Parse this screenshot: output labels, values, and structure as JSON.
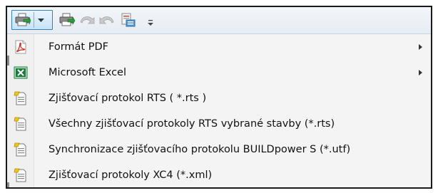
{
  "toolbar": {
    "buttons": [
      {
        "name": "print-split-icon"
      },
      {
        "name": "print-icon"
      },
      {
        "name": "undo-icon"
      },
      {
        "name": "redo-icon"
      },
      {
        "name": "export-icon"
      }
    ],
    "overflow_symbol": "⩧"
  },
  "menu": {
    "items": [
      {
        "label": "Formát PDF",
        "icon": "pdf-icon",
        "has_submenu": true
      },
      {
        "label": "Microsoft Excel",
        "icon": "excel-icon",
        "has_submenu": true
      },
      {
        "label": "Zjišťovací protokol RTS ( *.rts )",
        "icon": "document-icon",
        "has_submenu": false
      },
      {
        "label": "Všechny zjišťovací protokoly RTS vybrané stavby (*.rts)",
        "icon": "document-icon",
        "has_submenu": false
      },
      {
        "label": "Synchronizace zjišťovacího protokolu BUILDpower S (*.utf)",
        "icon": "document-icon",
        "has_submenu": false
      },
      {
        "label": "Zjišťovací protokoly XC4 (*.xml)",
        "icon": "document-icon",
        "has_submenu": false
      }
    ]
  },
  "colors": {
    "pdf_red": "#d42a1f",
    "excel_green": "#1e7a3c",
    "highlight_blue": "#3c7fb1"
  }
}
